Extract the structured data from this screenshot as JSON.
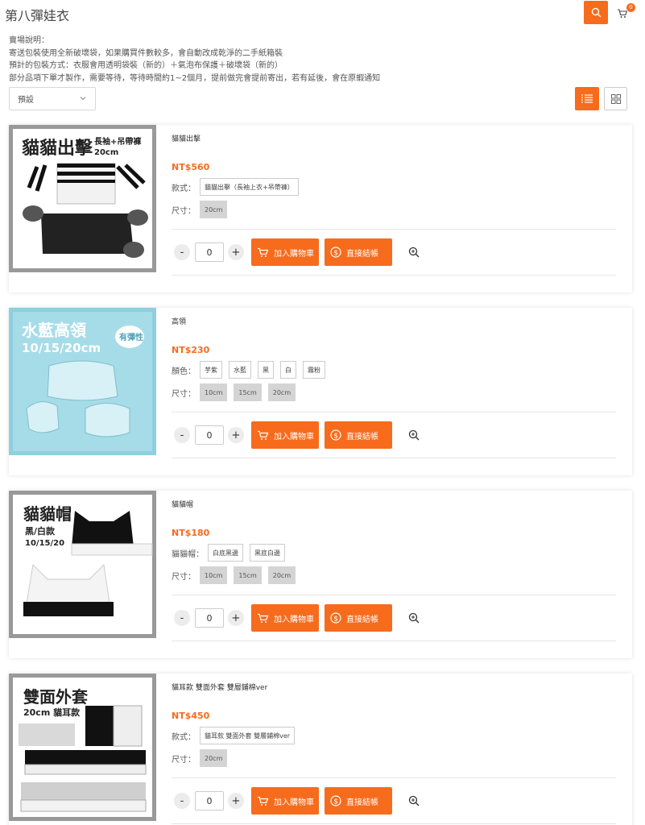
{
  "header": {
    "title": "第八彈娃衣",
    "cart_count": "0",
    "search_icon": "search-icon",
    "cart_icon": "cart-icon"
  },
  "notice": {
    "lines": [
      "賣場說明：",
      "寄送包裝使用全新破壞袋，如果購買件數較多，會自動改成乾淨的二手紙箱裝",
      "預計的包裝方式：衣服會用透明袋裝（新的）＋氣泡布保護＋破壞袋（新的）",
      "部分品項下單才製作，需要等待，等待時間約1~2個月，提前做完會提前寄出，若有延後，會在原蝦通知"
    ]
  },
  "toolbar": {
    "sort_value": "預設",
    "accent": "#f76b1c"
  },
  "actions": {
    "add_to_cart": "加入購物車",
    "checkout": "直接結帳"
  },
  "products": [
    {
      "name": "貓貓出擊",
      "price": "NT$560",
      "banner_title": "貓貓出擊",
      "banner_sub": "長袖+吊帶褲",
      "banner_size": "20cm",
      "options": [
        {
          "label": "款式：",
          "values": [
            "貓貓出擊（長袖上衣+吊帶褲）"
          ],
          "style": "outline"
        },
        {
          "label": "尺寸：",
          "values": [
            "20cm"
          ],
          "style": "grey"
        }
      ],
      "qty": "0"
    },
    {
      "name": "高領",
      "price": "NT$230",
      "banner_title": "水藍高領",
      "banner_size": "10/15/20cm",
      "banner_badge": "有彈性",
      "options": [
        {
          "label": "顏色：",
          "values": [
            "芋紫",
            "水藍",
            "黑",
            "白",
            "霧粉"
          ],
          "style": "outline"
        },
        {
          "label": "尺寸：",
          "values": [
            "10cm",
            "15cm",
            "20cm"
          ],
          "style": "grey"
        }
      ],
      "qty": "0"
    },
    {
      "name": "貓貓帽",
      "price": "NT$180",
      "banner_title": "貓貓帽",
      "banner_sub": "黑/白款",
      "banner_size": "10/15/20",
      "options": [
        {
          "label": "貓貓帽：",
          "values": [
            "白底黑邊",
            "黑底白邊"
          ],
          "style": "outline"
        },
        {
          "label": "尺寸：",
          "values": [
            "10cm",
            "15cm",
            "20cm"
          ],
          "style": "grey"
        }
      ],
      "qty": "0"
    },
    {
      "name": "貓耳款 雙面外套 雙層鋪棉ver",
      "price": "NT$450",
      "banner_title": "雙面外套",
      "banner_sub": "20cm 貓耳款",
      "options": [
        {
          "label": "款式：",
          "values": [
            "貓耳款 雙面外套 雙層鋪棉ver"
          ],
          "style": "outline"
        },
        {
          "label": "尺寸：",
          "values": [
            "20cm"
          ],
          "style": "grey"
        }
      ],
      "qty": "0"
    }
  ]
}
